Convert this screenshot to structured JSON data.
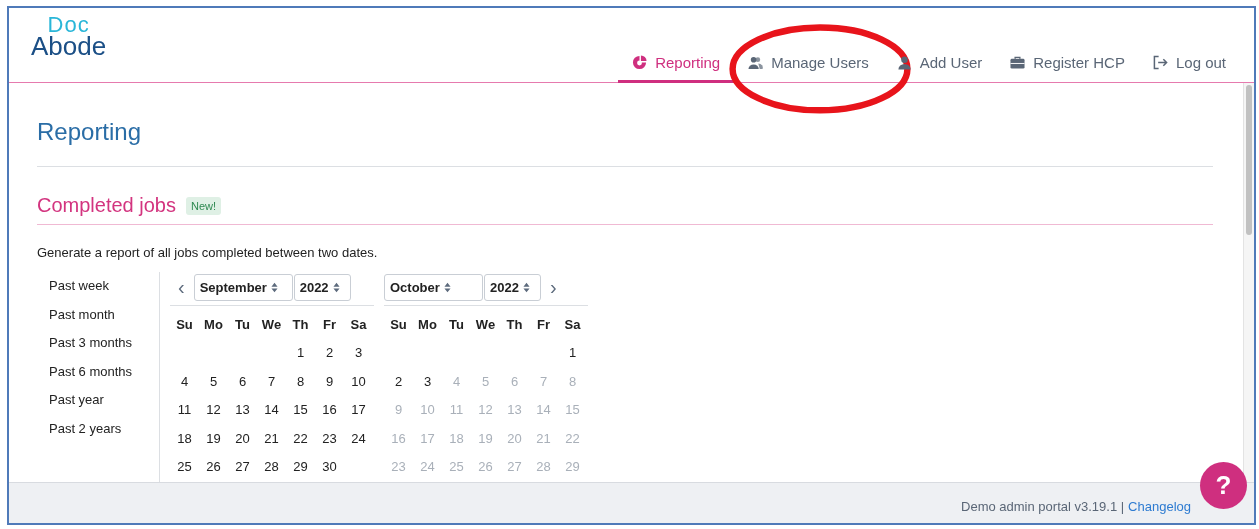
{
  "logo": {
    "top": "Doc",
    "bottom": "Abode"
  },
  "nav": [
    {
      "label": "Reporting",
      "selected": true
    },
    {
      "label": "Manage Users",
      "selected": false
    },
    {
      "label": "Add User",
      "selected": false
    },
    {
      "label": "Register HCP",
      "selected": false
    },
    {
      "label": "Log out",
      "selected": false
    }
  ],
  "page_title": "Reporting",
  "section": {
    "title": "Completed jobs",
    "badge": "New!",
    "description": "Generate a report of all jobs completed between two dates."
  },
  "presets": [
    "Past week",
    "Past month",
    "Past 3 months",
    "Past 6 months",
    "Past year",
    "Past 2 years"
  ],
  "prev_button": "‹",
  "next_button": "›",
  "calendars": [
    {
      "month": "September",
      "year": "2022",
      "weekdays": [
        "Su",
        "Mo",
        "Tu",
        "We",
        "Th",
        "Fr",
        "Sa"
      ],
      "weeks": [
        {
          "kind": "lead",
          "days": [
            {
              "day": "1",
              "disabled": false
            },
            {
              "day": "2",
              "disabled": false
            },
            {
              "day": "3",
              "disabled": false
            }
          ]
        },
        {
          "kind": "full",
          "days": [
            {
              "day": "4",
              "disabled": false
            },
            {
              "day": "5",
              "disabled": false
            },
            {
              "day": "6",
              "disabled": false
            },
            {
              "day": "7",
              "disabled": false
            },
            {
              "day": "8",
              "disabled": false
            },
            {
              "day": "9",
              "disabled": false
            },
            {
              "day": "10",
              "disabled": false
            }
          ]
        },
        {
          "kind": "full",
          "days": [
            {
              "day": "11",
              "disabled": false
            },
            {
              "day": "12",
              "disabled": false
            },
            {
              "day": "13",
              "disabled": false
            },
            {
              "day": "14",
              "disabled": false
            },
            {
              "day": "15",
              "disabled": false
            },
            {
              "day": "16",
              "disabled": false
            },
            {
              "day": "17",
              "disabled": false
            }
          ]
        },
        {
          "kind": "full",
          "days": [
            {
              "day": "18",
              "disabled": false
            },
            {
              "day": "19",
              "disabled": false
            },
            {
              "day": "20",
              "disabled": false
            },
            {
              "day": "21",
              "disabled": false
            },
            {
              "day": "22",
              "disabled": false
            },
            {
              "day": "23",
              "disabled": false
            },
            {
              "day": "24",
              "disabled": false
            }
          ]
        },
        {
          "kind": "tail",
          "days": [
            {
              "day": "25",
              "disabled": false
            },
            {
              "day": "26",
              "disabled": false
            },
            {
              "day": "27",
              "disabled": false
            },
            {
              "day": "28",
              "disabled": false
            },
            {
              "day": "29",
              "disabled": false
            },
            {
              "day": "30",
              "disabled": false
            }
          ]
        }
      ]
    },
    {
      "month": "October",
      "year": "2022",
      "weekdays": [
        "Su",
        "Mo",
        "Tu",
        "We",
        "Th",
        "Fr",
        "Sa"
      ],
      "weeks": [
        {
          "kind": "lead",
          "days": [
            {
              "day": "1",
              "disabled": false
            }
          ]
        },
        {
          "kind": "full",
          "days": [
            {
              "day": "2",
              "disabled": false
            },
            {
              "day": "3",
              "disabled": false
            },
            {
              "day": "4",
              "disabled": true
            },
            {
              "day": "5",
              "disabled": true
            },
            {
              "day": "6",
              "disabled": true
            },
            {
              "day": "7",
              "disabled": true
            },
            {
              "day": "8",
              "disabled": true
            }
          ]
        },
        {
          "kind": "full",
          "days": [
            {
              "day": "9",
              "disabled": true
            },
            {
              "day": "10",
              "disabled": true
            },
            {
              "day": "11",
              "disabled": true
            },
            {
              "day": "12",
              "disabled": true
            },
            {
              "day": "13",
              "disabled": true
            },
            {
              "day": "14",
              "disabled": true
            },
            {
              "day": "15",
              "disabled": true
            }
          ]
        },
        {
          "kind": "full",
          "days": [
            {
              "day": "16",
              "disabled": true
            },
            {
              "day": "17",
              "disabled": true
            },
            {
              "day": "18",
              "disabled": true
            },
            {
              "day": "19",
              "disabled": true
            },
            {
              "day": "20",
              "disabled": true
            },
            {
              "day": "21",
              "disabled": true
            },
            {
              "day": "22",
              "disabled": true
            }
          ]
        },
        {
          "kind": "full",
          "days": [
            {
              "day": "23",
              "disabled": true
            },
            {
              "day": "24",
              "disabled": true
            },
            {
              "day": "25",
              "disabled": true
            },
            {
              "day": "26",
              "disabled": true
            },
            {
              "day": "27",
              "disabled": true
            },
            {
              "day": "28",
              "disabled": true
            },
            {
              "day": "29",
              "disabled": true
            }
          ]
        }
      ]
    }
  ],
  "footer": {
    "text": "Demo admin portal v3.19.1 |",
    "link": "Changelog"
  },
  "help_button": "?"
}
